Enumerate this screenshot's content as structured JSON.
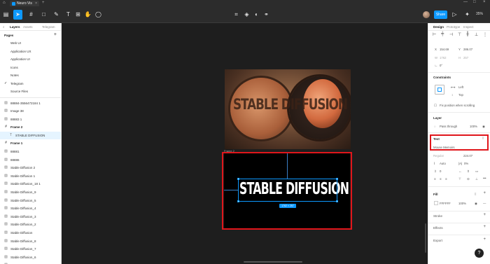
{
  "topbar": {
    "tab_title": "Neuro Vis",
    "tab_close": "×",
    "new_tab": "+",
    "window_controls": [
      "—",
      "□",
      "×"
    ]
  },
  "toolbar": {
    "share_label": "Share",
    "zoom": "35%",
    "icons": [
      "main-menu-icon",
      "move-tool-icon",
      "frame-tool-icon",
      "shape-tool-icon",
      "pen-tool-icon",
      "text-tool-icon",
      "resource-tool-icon",
      "hand-tool-icon",
      "comment-tool-icon",
      "crop-icon",
      "component-icon",
      "contrast-icon",
      "link-icon",
      "present-icon",
      "ai-icon"
    ]
  },
  "left_panel": {
    "tabs": [
      "Layers",
      "Assets",
      "Telegram"
    ],
    "pages_label": "Pages",
    "pages": [
      {
        "label": "Web UI",
        "current": false
      },
      {
        "label": "Application UX",
        "current": false
      },
      {
        "label": "Application UI",
        "current": false
      },
      {
        "label": "Icons",
        "current": false
      },
      {
        "label": "Notes",
        "current": false
      },
      {
        "label": "Telegram",
        "current": true
      },
      {
        "label": "Source Files",
        "current": false
      }
    ],
    "layers": [
      {
        "label": "88884-3556472184 1",
        "type": "image",
        "indent": 0
      },
      {
        "label": "Image 38",
        "type": "image",
        "indent": 0
      },
      {
        "label": "88883 1",
        "type": "image",
        "indent": 0
      },
      {
        "label": "Frame 2",
        "type": "frame",
        "indent": 0
      },
      {
        "label": "STABLE DIFFUSION",
        "type": "text",
        "indent": 1,
        "selected": true
      },
      {
        "label": "Frame 1",
        "type": "frame",
        "indent": 0
      },
      {
        "label": "88881",
        "type": "image",
        "indent": 0
      },
      {
        "label": "88886",
        "type": "image",
        "indent": 0
      },
      {
        "label": "Stable Diffusion 2",
        "type": "image",
        "indent": 0
      },
      {
        "label": "Stable Diffusion 1",
        "type": "image",
        "indent": 0
      },
      {
        "label": "Stable Diffusion_18 1",
        "type": "image",
        "indent": 0
      },
      {
        "label": "Stable Diffusion_9",
        "type": "image",
        "indent": 0
      },
      {
        "label": "Stable Diffusion_5",
        "type": "image",
        "indent": 0
      },
      {
        "label": "Stable Diffusion_4",
        "type": "image",
        "indent": 0
      },
      {
        "label": "Stable Diffusion_3",
        "type": "image",
        "indent": 0
      },
      {
        "label": "Stable Diffusion_2",
        "type": "image",
        "indent": 0
      },
      {
        "label": "Stable Diffusion",
        "type": "image",
        "indent": 0
      },
      {
        "label": "Stable Diffusion_8",
        "type": "image",
        "indent": 0
      },
      {
        "label": "Stable Diffusion_7",
        "type": "image",
        "indent": 0
      },
      {
        "label": "Stable Diffusion_6",
        "type": "image",
        "indent": 0
      },
      {
        "label": "Image 36",
        "type": "image",
        "indent": 0
      }
    ]
  },
  "canvas": {
    "image_text": "STABLE DIFFUSION",
    "frame_label": "Frame 2",
    "main_text": "STABLE DIFFUSION",
    "size_badge": "1762 × 257"
  },
  "right_panel": {
    "tabs": [
      "Design",
      "Prototype",
      "Inspect"
    ],
    "x": "154.69",
    "y": "286.07",
    "w": "1762",
    "h": "257",
    "rotation": "0°",
    "constraints_title": "Constraints",
    "constraint_h": "Left",
    "constraint_v": "Top",
    "fix_position": "Fix position when scrolling",
    "layer_title": "Layer",
    "blend": "Pass through",
    "opacity": "100%",
    "text_title": "Text",
    "font_family": "Mouse Memoirs",
    "font_style": "Regular",
    "font_size": "224.07",
    "line_height": "Auto",
    "letter_spacing": "0%",
    "paragraph_spacing": "0",
    "fill_title": "Fill",
    "fill_hex": "FFFFFF",
    "fill_opacity": "100%",
    "stroke_title": "Stroke",
    "effects_title": "Effects",
    "export_title": "Export",
    "help": "?"
  }
}
